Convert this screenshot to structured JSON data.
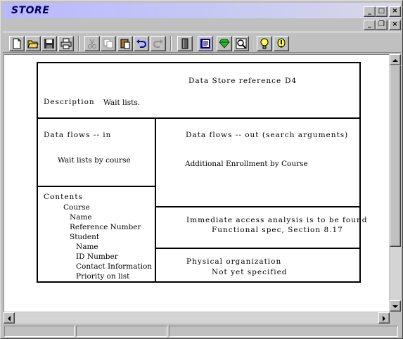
{
  "window": {
    "title": "STORE",
    "controls": {
      "minimize": "_",
      "maximize": "□",
      "close": "×",
      "restore": "❐"
    }
  },
  "toolbar": {
    "buttons": [
      "new-document",
      "open-folder",
      "save",
      "print",
      "cut",
      "copy",
      "paste",
      "undo",
      "redo",
      "book",
      "document-view",
      "gem",
      "zoom",
      "lightbulb",
      "info"
    ]
  },
  "form": {
    "header": {
      "label": "Data Store reference",
      "ref": "D4"
    },
    "description": {
      "label": "Description",
      "value": "Wait lists."
    },
    "flows_in": {
      "label": "Data flows -- in",
      "value": "Wait lists by course"
    },
    "flows_out": {
      "label": "Data flows -- out (search arguments)",
      "value": "Additional Enrollment by Course"
    },
    "contents": {
      "label": "Contents",
      "items": [
        {
          "text": "Course",
          "level": 1
        },
        {
          "text": "Name",
          "level": 2
        },
        {
          "text": "Reference Number",
          "level": 2
        },
        {
          "text": "Student",
          "level": 2
        },
        {
          "text": "Name",
          "level": 3
        },
        {
          "text": "ID Number",
          "level": 3
        },
        {
          "text": "Contact Information",
          "level": 3
        },
        {
          "text": "Priority on list",
          "level": 3
        }
      ]
    },
    "access": {
      "label": "Immediate access analysis is to be found",
      "value": "Functional spec, Section 8.17"
    },
    "physical": {
      "label": "Physical organization",
      "value": "Not yet specified"
    }
  },
  "colors": {
    "titlebar_start": "#b8b8ff",
    "titlebar_text": "#000060",
    "chrome": "#c0c0c0"
  }
}
